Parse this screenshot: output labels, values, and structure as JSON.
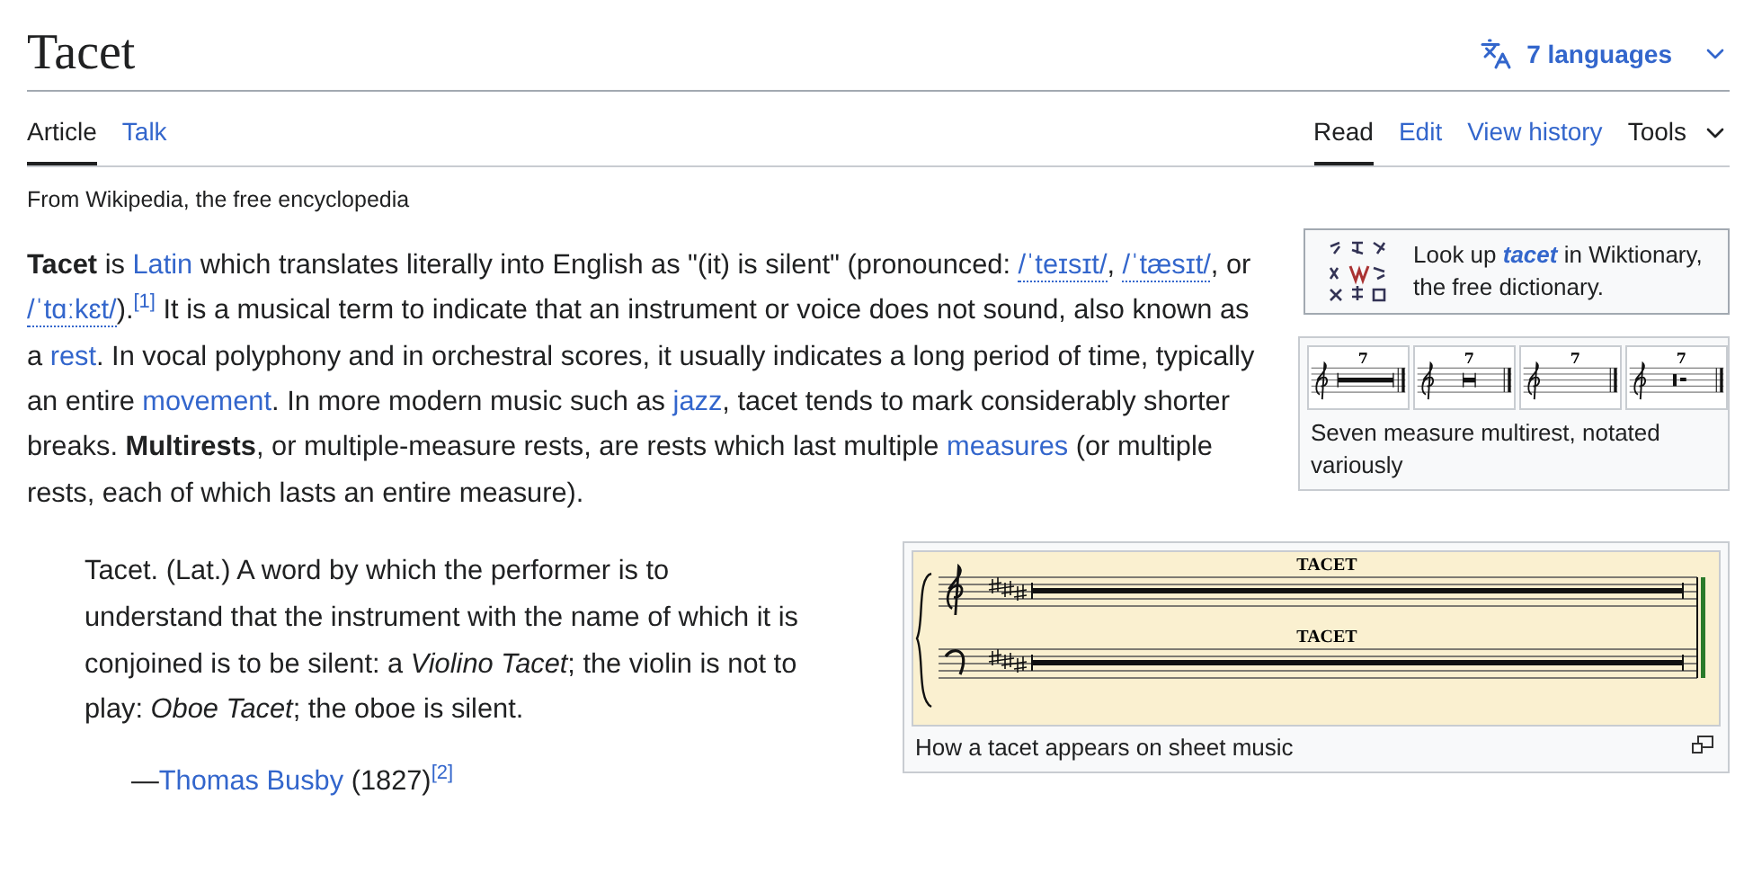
{
  "header": {
    "title": "Tacet",
    "languages": "7 languages"
  },
  "tabs_left": [
    {
      "label": "Article",
      "selected": true
    },
    {
      "label": "Talk",
      "selected": false
    }
  ],
  "tabs_right": [
    {
      "label": "Read",
      "selected": true
    },
    {
      "label": "Edit",
      "selected": false
    },
    {
      "label": "View history",
      "selected": false
    }
  ],
  "tools": "Tools",
  "tagline": "From Wikipedia, the free encyclopedia",
  "wiktionary": [
    {
      "kind": "text",
      "text": "Look up "
    },
    {
      "kind": "emphasis-link",
      "text": "tacet"
    },
    {
      "kind": "text",
      "text": " in Wiktionary, the free dictionary."
    }
  ],
  "multirest_figure": {
    "panels": [
      {
        "kind": "long-bar",
        "number": "7"
      },
      {
        "kind": "short-bar",
        "number": "7"
      },
      {
        "kind": "empty",
        "number": "7"
      },
      {
        "kind": "rests",
        "number": "7"
      }
    ],
    "caption": "Seven measure multirest, notated variously"
  },
  "lead_paragraph": [
    {
      "kind": "bold",
      "text": "Tacet"
    },
    {
      "kind": "text",
      "text": " is "
    },
    {
      "kind": "link",
      "text": "Latin"
    },
    {
      "kind": "text",
      "text": " which translates literally into English as \"(it) is silent\" (pronounced: "
    },
    {
      "kind": "ipa",
      "text": "/ˈteɪsɪt/"
    },
    {
      "kind": "text",
      "text": ", "
    },
    {
      "kind": "ipa",
      "text": "/ˈtæsɪt/"
    },
    {
      "kind": "text",
      "text": ", or "
    },
    {
      "kind": "ipa",
      "text": "/ˈtɑːkɛt/"
    },
    {
      "kind": "text",
      "text": ")."
    },
    {
      "kind": "ref",
      "text": "[1]"
    },
    {
      "kind": "text",
      "text": " It is a musical term to indicate that an instrument or voice does not sound, also known as a "
    },
    {
      "kind": "link",
      "text": "rest"
    },
    {
      "kind": "text",
      "text": ". In vocal polyphony and in orchestral scores, it usually indicates a long period of time, typically an entire "
    },
    {
      "kind": "link",
      "text": "movement"
    },
    {
      "kind": "text",
      "text": ". In more modern music such as "
    },
    {
      "kind": "link",
      "text": "jazz"
    },
    {
      "kind": "text",
      "text": ", tacet tends to mark considerably shorter breaks. "
    },
    {
      "kind": "bold",
      "text": "Multirests"
    },
    {
      "kind": "text",
      "text": ", or multiple-measure rests, are rests which last multiple "
    },
    {
      "kind": "link",
      "text": "measures"
    },
    {
      "kind": "text",
      "text": " (or multiple rests, each of which lasts an entire measure)."
    }
  ],
  "quote": {
    "text": [
      {
        "kind": "text",
        "text": "Tacet. (Lat.) A word by which the performer is to understand that the instrument with the name of which it is conjoined is to be silent: a "
      },
      {
        "kind": "italic",
        "text": "Violino Tacet"
      },
      {
        "kind": "text",
        "text": "; the violin is not to play: "
      },
      {
        "kind": "italic",
        "text": "Oboe Tacet"
      },
      {
        "kind": "text",
        "text": "; the oboe is silent."
      }
    ],
    "attribution": [
      {
        "kind": "text",
        "text": "—"
      },
      {
        "kind": "link",
        "text": "Thomas Busby"
      },
      {
        "kind": "text",
        "text": " (1827)"
      },
      {
        "kind": "ref",
        "text": "[2]"
      }
    ]
  },
  "score_figure": {
    "staves": [
      {
        "kind": "treble",
        "label": "TACET"
      },
      {
        "kind": "bass",
        "label": "TACET"
      }
    ],
    "caption": "How a tacet appears on sheet music"
  }
}
